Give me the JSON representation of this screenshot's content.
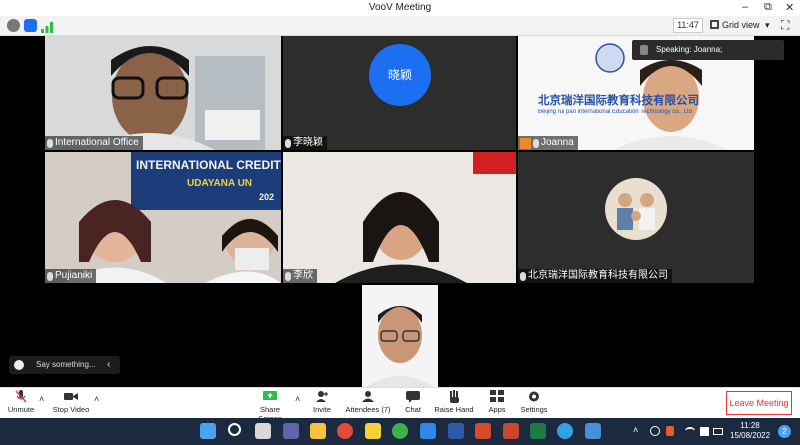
{
  "window": {
    "title": "VooV Meeting",
    "minimize": "–",
    "restore": "⧉",
    "close": "✕"
  },
  "top_toolbar": {
    "timer": "11:47",
    "view_label": "Grid view",
    "view_arrow": "▾",
    "fullscreen": "⛶"
  },
  "speaking": {
    "label": "Speaking: Joanna;"
  },
  "participants": [
    {
      "name": "International Office"
    },
    {
      "name": "李晓颖",
      "avatar_text": "晓颖"
    },
    {
      "name": "Joanna",
      "banner_cn": "北京瑞洋国际教育科技有限公司",
      "banner_en": "Beijing rui pan international Education Technology co., Ltd"
    },
    {
      "name": "Pujianiki",
      "banner_line1": "INTERNATIONAL CREDIT T",
      "banner_line2": "UDAYANA UN",
      "banner_line3": "202"
    },
    {
      "name": "李欣"
    },
    {
      "name": "北京瑞洋国际教育科技有限公司"
    },
    {
      "name": ""
    }
  ],
  "chat": {
    "placeholder": "Say something...",
    "collapse": "‹"
  },
  "controls": {
    "unmute": "Unmute",
    "stop_video": "Stop Video",
    "share_screen": "Share Screen",
    "invite": "Invite",
    "attendees": "Attendees (7)",
    "chat": "Chat",
    "raise_hand": "Raise Hand",
    "apps": "Apps",
    "settings": "Settings",
    "leave": "Leave Meeting",
    "caret": "˄"
  },
  "taskbar": {
    "time": "11:28",
    "date": "15/08/2022",
    "notifications": "2"
  },
  "colors": {
    "accent_blue": "#1d6ff2",
    "leave_red": "#e33333",
    "taskbar_bg": "#1b2a3e"
  }
}
